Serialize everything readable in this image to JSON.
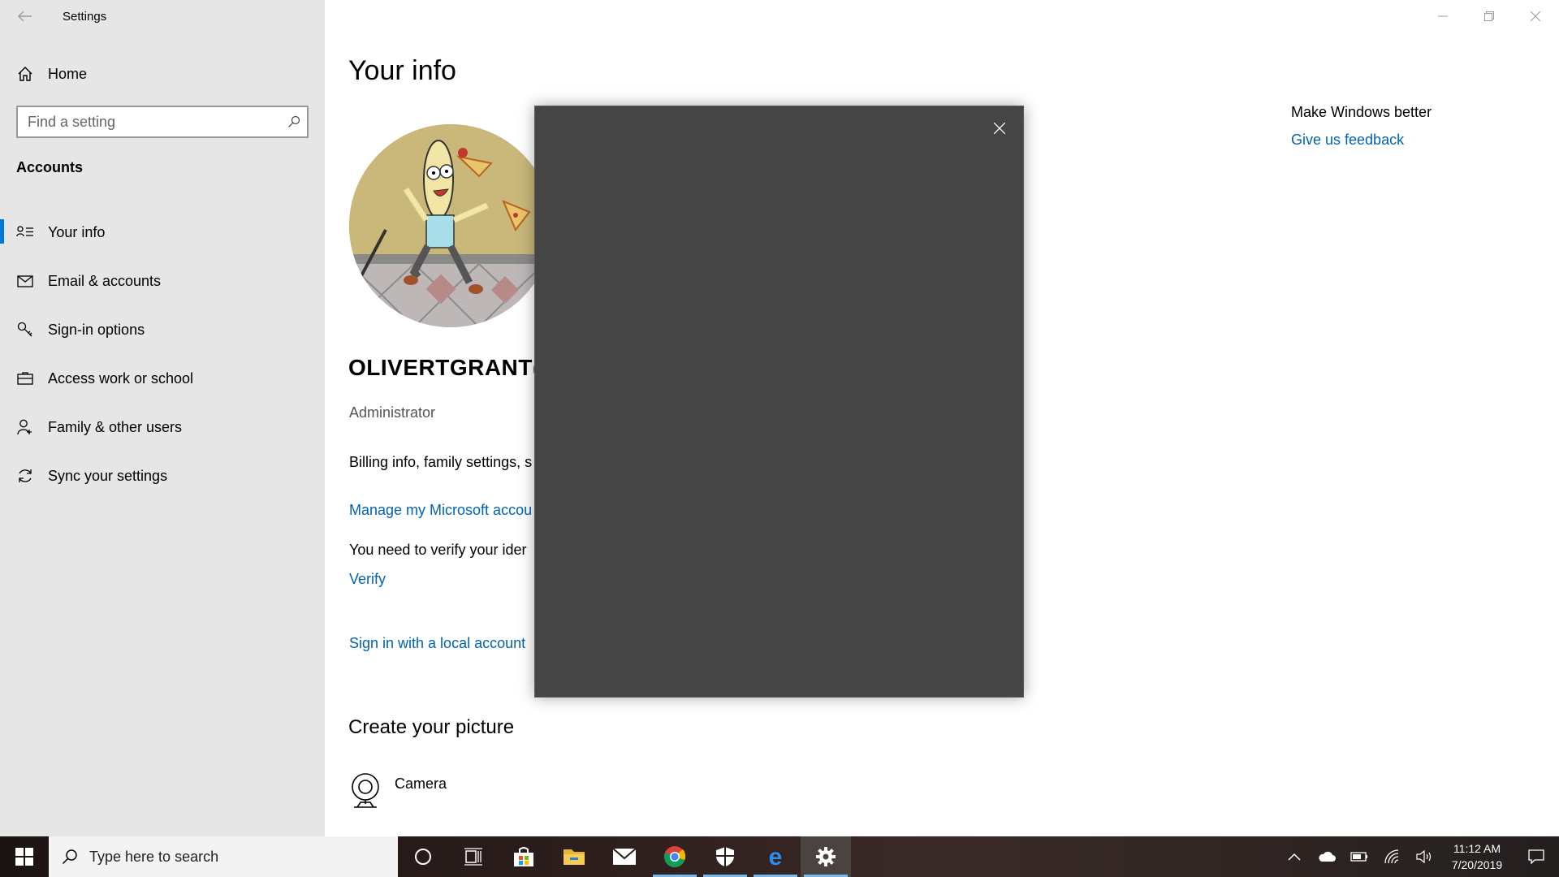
{
  "app": {
    "title": "Settings"
  },
  "sidebar": {
    "home_label": "Home",
    "search_placeholder": "Find a setting",
    "section_title": "Accounts",
    "items": [
      {
        "label": "Your info",
        "icon": "contact-card-icon",
        "active": true
      },
      {
        "label": "Email & accounts",
        "icon": "mail-icon",
        "active": false
      },
      {
        "label": "Sign-in options",
        "icon": "key-icon",
        "active": false
      },
      {
        "label": "Access work or school",
        "icon": "briefcase-icon",
        "active": false
      },
      {
        "label": "Family & other users",
        "icon": "person-add-icon",
        "active": false
      },
      {
        "label": "Sync your settings",
        "icon": "sync-icon",
        "active": false
      }
    ]
  },
  "main": {
    "title": "Your info",
    "username": "OLIVERTGRANT(",
    "role": "Administrator",
    "billing_text": "Billing info, family settings, s more",
    "manage_link": "Manage my Microsoft accou",
    "verify_text": "You need to verify your ider",
    "verify_link": "Verify",
    "local_link": "Sign in with a local account",
    "create_title": "Create your picture",
    "camera_label": "Camera"
  },
  "side_panel": {
    "header": "Make Windows better",
    "feedback_link": "Give us feedback"
  },
  "taskbar": {
    "search_placeholder": "Type here to search",
    "pinned": [
      "cortana-icon",
      "task-view-icon",
      "store-icon",
      "file-explorer-icon",
      "mail-icon",
      "chrome-icon",
      "security-icon",
      "edge-icon",
      "settings-icon"
    ],
    "time": "11:12 AM",
    "date": "7/20/2019"
  },
  "colors": {
    "accent": "#0078d7",
    "link": "#0063b1",
    "sidebar_bg": "#e6e6e6",
    "dialog_bg": "#454545"
  }
}
